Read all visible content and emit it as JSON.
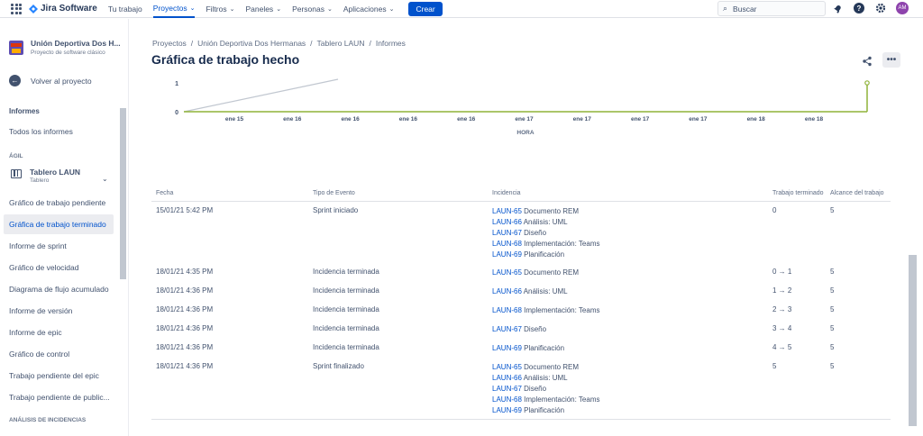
{
  "topnav": {
    "product": "Jira Software",
    "items": [
      {
        "label": "Tu trabajo",
        "chevron": false,
        "active": false
      },
      {
        "label": "Proyectos",
        "chevron": true,
        "active": true
      },
      {
        "label": "Filtros",
        "chevron": true,
        "active": false
      },
      {
        "label": "Paneles",
        "chevron": true,
        "active": false
      },
      {
        "label": "Personas",
        "chevron": true,
        "active": false
      },
      {
        "label": "Aplicaciones",
        "chevron": true,
        "active": false
      }
    ],
    "create_label": "Crear",
    "search_placeholder": "Buscar",
    "avatar_initials": "AM",
    "icons": [
      "app-switcher-icon",
      "notifications-icon",
      "help-icon",
      "settings-icon"
    ]
  },
  "sidebar": {
    "project_name": "Unión Deportiva Dos H...",
    "project_type": "Proyecto de software clásico",
    "back_label": "Volver al proyecto",
    "reports_heading": "Informes",
    "all_reports": "Todos los informes",
    "agile_heading": "ÁGIL",
    "board_name": "Tablero LAUN",
    "board_type": "Tablero",
    "items": [
      {
        "label": "Gráfico de trabajo pendiente",
        "selected": false
      },
      {
        "label": "Gráfica de trabajo terminado",
        "selected": true
      },
      {
        "label": "Informe de sprint",
        "selected": false
      },
      {
        "label": "Gráfico de velocidad",
        "selected": false
      },
      {
        "label": "Diagrama de flujo acumulado",
        "selected": false
      },
      {
        "label": "Informe de versión",
        "selected": false
      },
      {
        "label": "Informe de epic",
        "selected": false
      },
      {
        "label": "Gráfico de control",
        "selected": false
      },
      {
        "label": "Trabajo pendiente del epic",
        "selected": false
      },
      {
        "label": "Trabajo pendiente de public...",
        "selected": false
      }
    ],
    "issue_analysis_heading": "ANÁLISIS DE INCIDENCIAS"
  },
  "breadcrumb": [
    "Proyectos",
    "Unión Deportiva Dos Hermanas",
    "Tablero LAUN",
    "Informes"
  ],
  "page_title": "Gráfica de trabajo hecho",
  "chart": {
    "y_ticks": [
      "1",
      "0"
    ],
    "x_ticks": [
      "ene 15",
      "ene 16",
      "ene 16",
      "ene 16",
      "ene 16",
      "ene 17",
      "ene 17",
      "ene 17",
      "ene 17",
      "ene 18",
      "ene 18"
    ],
    "x_axis_title": "HORA",
    "colors": {
      "completed": "#8fb339",
      "guideline": "#c1c7d0",
      "axis": "#5e6c84"
    }
  },
  "table": {
    "headers": [
      "Fecha",
      "Tipo de Evento",
      "Incidencia",
      "Trabajo terminado",
      "Alcance del trabajo"
    ],
    "rows": [
      {
        "date": "15/01/21 5:42 PM",
        "event": "Sprint iniciado",
        "issues": [
          {
            "key": "LAUN-65",
            "summary": "Documento REM"
          },
          {
            "key": "LAUN-66",
            "summary": "Análisis: UML"
          },
          {
            "key": "LAUN-67",
            "summary": "Diseño"
          },
          {
            "key": "LAUN-68",
            "summary": "Implementación: Teams"
          },
          {
            "key": "LAUN-69",
            "summary": "Planificación"
          }
        ],
        "done": "0",
        "scope": "5"
      },
      {
        "date": "18/01/21 4:35 PM",
        "event": "Incidencia terminada",
        "issues": [
          {
            "key": "LAUN-65",
            "summary": "Documento REM"
          }
        ],
        "done": "0 → 1",
        "scope": "5"
      },
      {
        "date": "18/01/21 4:36 PM",
        "event": "Incidencia terminada",
        "issues": [
          {
            "key": "LAUN-66",
            "summary": "Análisis: UML"
          }
        ],
        "done": "1 → 2",
        "scope": "5"
      },
      {
        "date": "18/01/21 4:36 PM",
        "event": "Incidencia terminada",
        "issues": [
          {
            "key": "LAUN-68",
            "summary": "Implementación: Teams"
          }
        ],
        "done": "2 → 3",
        "scope": "5"
      },
      {
        "date": "18/01/21 4:36 PM",
        "event": "Incidencia terminada",
        "issues": [
          {
            "key": "LAUN-67",
            "summary": "Diseño"
          }
        ],
        "done": "3 → 4",
        "scope": "5"
      },
      {
        "date": "18/01/21 4:36 PM",
        "event": "Incidencia terminada",
        "issues": [
          {
            "key": "LAUN-69",
            "summary": "Planificación"
          }
        ],
        "done": "4 → 5",
        "scope": "5"
      },
      {
        "date": "18/01/21 4:36 PM",
        "event": "Sprint finalizado",
        "issues": [
          {
            "key": "LAUN-65",
            "summary": "Documento REM"
          },
          {
            "key": "LAUN-66",
            "summary": "Análisis: UML"
          },
          {
            "key": "LAUN-67",
            "summary": "Diseño"
          },
          {
            "key": "LAUN-68",
            "summary": "Implementación: Teams"
          },
          {
            "key": "LAUN-69",
            "summary": "Planificación"
          }
        ],
        "done": "5",
        "scope": "5"
      }
    ]
  }
}
